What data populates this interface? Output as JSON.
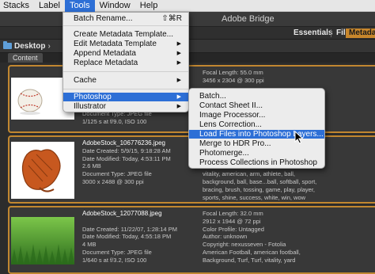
{
  "menubar": {
    "items": [
      "Stacks",
      "Label",
      "Tools",
      "Window",
      "Help"
    ],
    "active": "Tools"
  },
  "titlebar": {
    "title": "Adobe Bridge"
  },
  "toolbar": {
    "workspaces": [
      "Essentials",
      "Filmstrip",
      "Metadata"
    ],
    "active_workspace": "Metadata"
  },
  "pathbar": {
    "folder": "Desktop",
    "folder_icon": "folder-icon"
  },
  "content_tab": "Content",
  "tools_menu": {
    "items": [
      {
        "label": "Batch Rename...",
        "shortcut": "⇧⌘R"
      },
      {
        "label": "Create Metadata Template..."
      },
      {
        "label": "Edit Metadata Template",
        "submenu": true
      },
      {
        "label": "Append Metadata",
        "submenu": true
      },
      {
        "label": "Replace Metadata",
        "submenu": true
      },
      {
        "label": "Cache",
        "submenu": true
      },
      {
        "label": "Photoshop",
        "submenu": true,
        "highlighted": true
      },
      {
        "label": "Illustrator",
        "submenu": true
      }
    ]
  },
  "photoshop_submenu": {
    "items": [
      {
        "label": "Batch..."
      },
      {
        "label": "Contact Sheet II..."
      },
      {
        "label": "Image Processor..."
      },
      {
        "label": "Lens Correction..."
      },
      {
        "label": "Load Files into Photoshop Layers...",
        "highlighted": true
      },
      {
        "label": "Merge to HDR Pro..."
      },
      {
        "label": "Photomerge..."
      },
      {
        "label": "Process Collections in Photoshop"
      }
    ]
  },
  "items": [
    {
      "thumbnail": "baseball-thumbnail",
      "left": [
        "Document Type: JPEG file",
        "1/125 s at f/9.0, ISO 100"
      ],
      "right": [
        "Focal Length: 55.0 mm",
        "3456 x 2304 @ 300 ppi"
      ]
    },
    {
      "thumbnail": "baseball-glove-thumbnail",
      "left": [
        "AdobeStock_106776236.jpeg",
        "",
        "Date Created: 5/9/15, 9:18:28 AM",
        "Date Modified: Today, 4:53:11 PM",
        "2.6 MB",
        "Document Type: JPEG file",
        "3000 x 2488 @ 300 ppi"
      ],
      "right": [
        "",
        "",
        "",
        "",
        "vitality, american, arm, athlete, ball,",
        "background, ball, base...ball, softball, sport,",
        "bracing, brush, tossing, game, play, player,",
        "sports, shine, success, white, win, wow"
      ]
    },
    {
      "thumbnail": "grass-field-thumbnail",
      "left": [
        "AdobeStock_12077088.jpeg",
        "",
        "Date Created: 11/22/07, 1:28:14 PM",
        "Date Modified: Today, 4:55:18 PM",
        "4 MB",
        "Document Type: JPEG file",
        "1/640 s at f/3.2, ISO 100"
      ],
      "right": [
        "Focal Length: 32.0 mm",
        "2912 x 1944 @ 72 ppi",
        "Color Profile: Untagged",
        "Author: unknown",
        "Copyright: nexusseven - Fotolia",
        "American Football, american football,",
        "Background, Turf, Turf, vitality, yard"
      ]
    }
  ]
}
